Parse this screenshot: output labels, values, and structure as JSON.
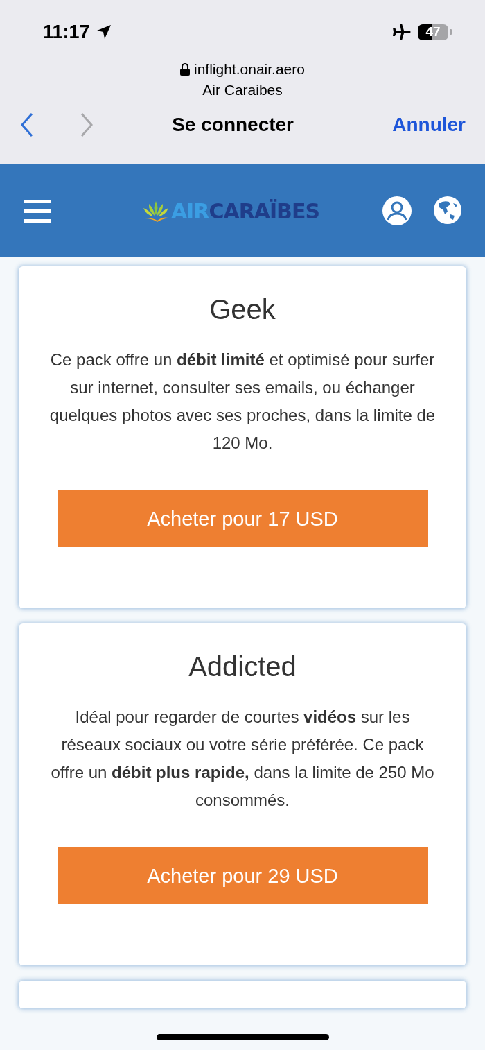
{
  "status_bar": {
    "time": "11:17",
    "battery": "47"
  },
  "browser": {
    "domain": "inflight.onair.aero",
    "site": "Air Caraibes",
    "title": "Se connecter",
    "cancel": "Annuler",
    "back_enabled": true,
    "forward_enabled": false
  },
  "header": {
    "logo_light": "AIR",
    "logo_dark": "CARAÏBES"
  },
  "packs": [
    {
      "name": "Geek",
      "description": "Ce pack offre un **débit limité** et optimisé pour surfer sur internet, consulter ses emails, ou échanger quelques photos avec ses proches, dans la limite de 120 Mo.",
      "button": "Acheter pour 17 USD"
    },
    {
      "name": "Addicted",
      "description": "Idéal pour regarder de courtes **vidéos** sur les réseaux sociaux ou votre série préférée. Ce pack offre un **débit plus rapide,** dans la limite de 250 Mo consommés.",
      "button": "Acheter pour 29 USD"
    }
  ]
}
